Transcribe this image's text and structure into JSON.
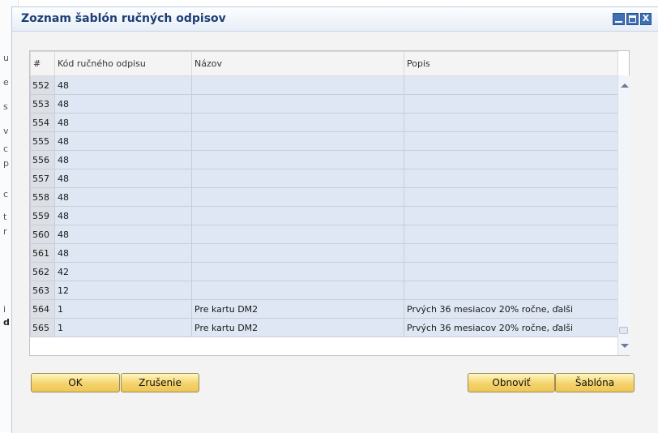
{
  "background_fragments": [
    "u",
    "e",
    "s",
    "v",
    "c",
    "p",
    "c",
    "t",
    "r",
    "i",
    "d"
  ],
  "window": {
    "title": "Zoznam šablón ručných odpisov",
    "controls": {
      "close_glyph": "X"
    }
  },
  "table": {
    "columns": [
      "#",
      "Kód ručného odpisu",
      "Názov",
      "Popis"
    ],
    "rows": [
      {
        "num": "552",
        "code": "48",
        "name": "",
        "desc": ""
      },
      {
        "num": "553",
        "code": "48",
        "name": "",
        "desc": ""
      },
      {
        "num": "554",
        "code": "48",
        "name": "",
        "desc": ""
      },
      {
        "num": "555",
        "code": "48",
        "name": "",
        "desc": ""
      },
      {
        "num": "556",
        "code": "48",
        "name": "",
        "desc": ""
      },
      {
        "num": "557",
        "code": "48",
        "name": "",
        "desc": ""
      },
      {
        "num": "558",
        "code": "48",
        "name": "",
        "desc": ""
      },
      {
        "num": "559",
        "code": "48",
        "name": "",
        "desc": ""
      },
      {
        "num": "560",
        "code": "48",
        "name": "",
        "desc": ""
      },
      {
        "num": "561",
        "code": "48",
        "name": "",
        "desc": ""
      },
      {
        "num": "562",
        "code": "42",
        "name": "",
        "desc": ""
      },
      {
        "num": "563",
        "code": "12",
        "name": "",
        "desc": ""
      },
      {
        "num": "564",
        "code": "1",
        "name": "Pre kartu DM2",
        "desc": "Prvých 36 mesiacov 20% ročne, ďalši"
      },
      {
        "num": "565",
        "code": "1",
        "name": "Pre kartu DM2",
        "desc": "Prvých 36 mesiacov 20% ročne, ďalši"
      }
    ]
  },
  "buttons": {
    "ok": "OK",
    "cancel": "Zrušenie",
    "refresh": "Obnoviť",
    "template": "Šablóna"
  },
  "colors": {
    "row_background": "#dee7f3",
    "button_gold": "#f4d36a",
    "title_text": "#1b3f74",
    "window_buttons": "#3f6fb4"
  }
}
